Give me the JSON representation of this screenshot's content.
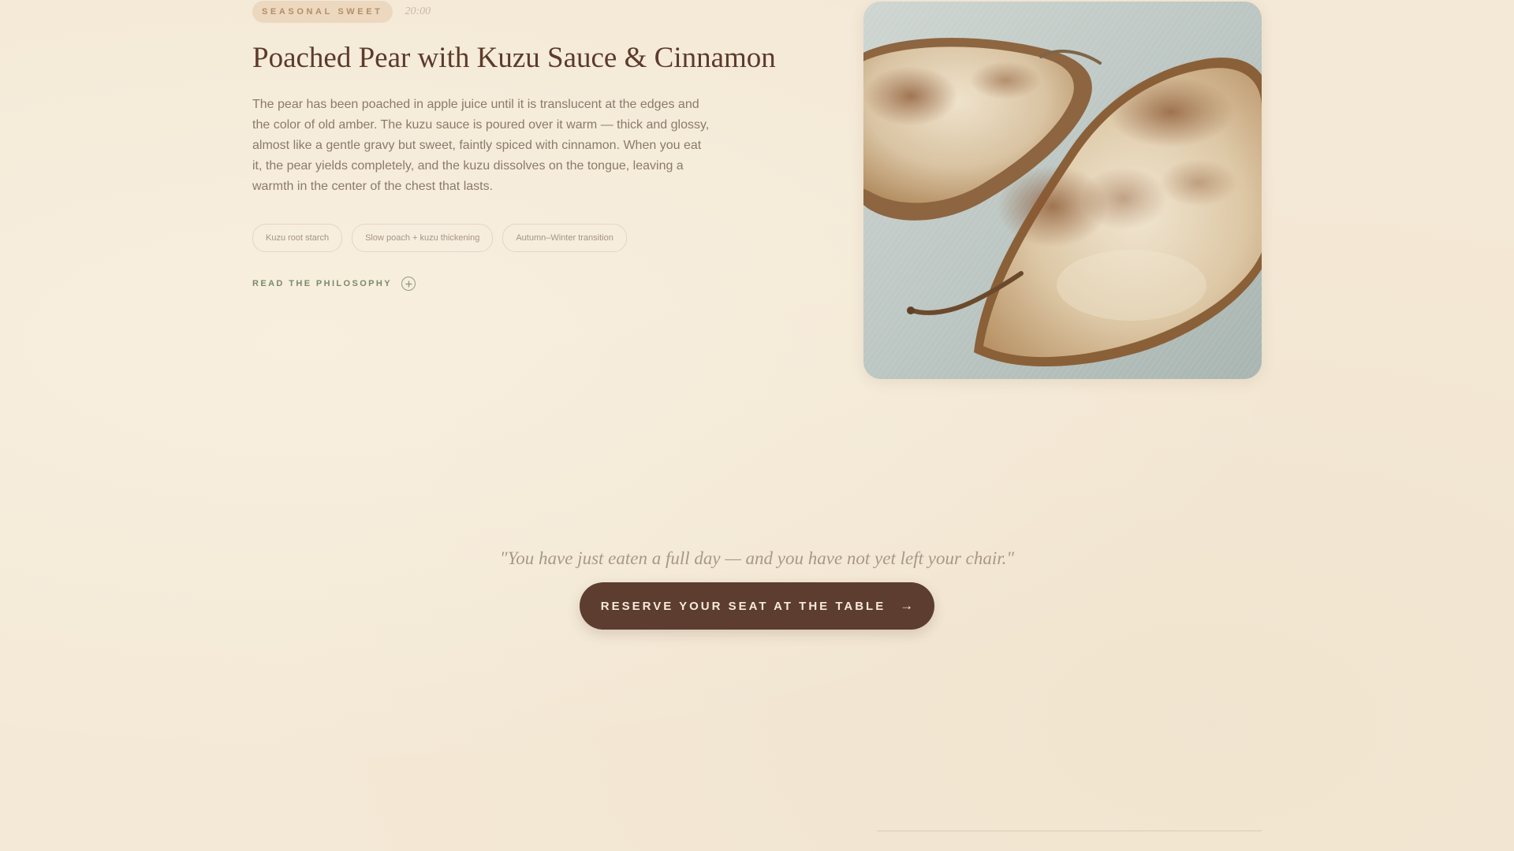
{
  "course": {
    "badge": "SEASONAL SWEET",
    "time": "20:00",
    "title": "Poached Pear with Kuzu Sauce & Cinnamon",
    "description": "The pear has been poached in apple juice until it is translucent at the edges and the color of old amber. The kuzu sauce is poured over it warm — thick and glossy, almost like a gentle gravy but sweet, faintly spiced with cinnamon. When you eat it, the pear yields completely, and the kuzu dissolves on the tongue, leaving a warmth in the center of the chest that lasts.",
    "tags": [
      "Kuzu root starch",
      "Slow poach + kuzu thickening",
      "Autumn–Winter transition"
    ],
    "philosophy_link": "READ THE PHILOSOPHY",
    "philosophy_icon": "plus-circle-icon",
    "image_subject": "poached-pear-photo"
  },
  "closing": {
    "quote": "\"You have just eaten a full day — and you have not yet left your chair.\"",
    "cta_label": "RESERVE YOUR SEAT AT THE TABLE",
    "cta_arrow": "→"
  },
  "colors": {
    "background": "#f4e9d6",
    "title": "#5c3b2c",
    "body_text": "#8c7a6c",
    "badge_bg": "#ecd8bf",
    "badge_text": "#b58d67",
    "link_sage": "#7b8a6a",
    "cta_bg": "#5c3d30",
    "cta_text": "#f6eadb"
  }
}
